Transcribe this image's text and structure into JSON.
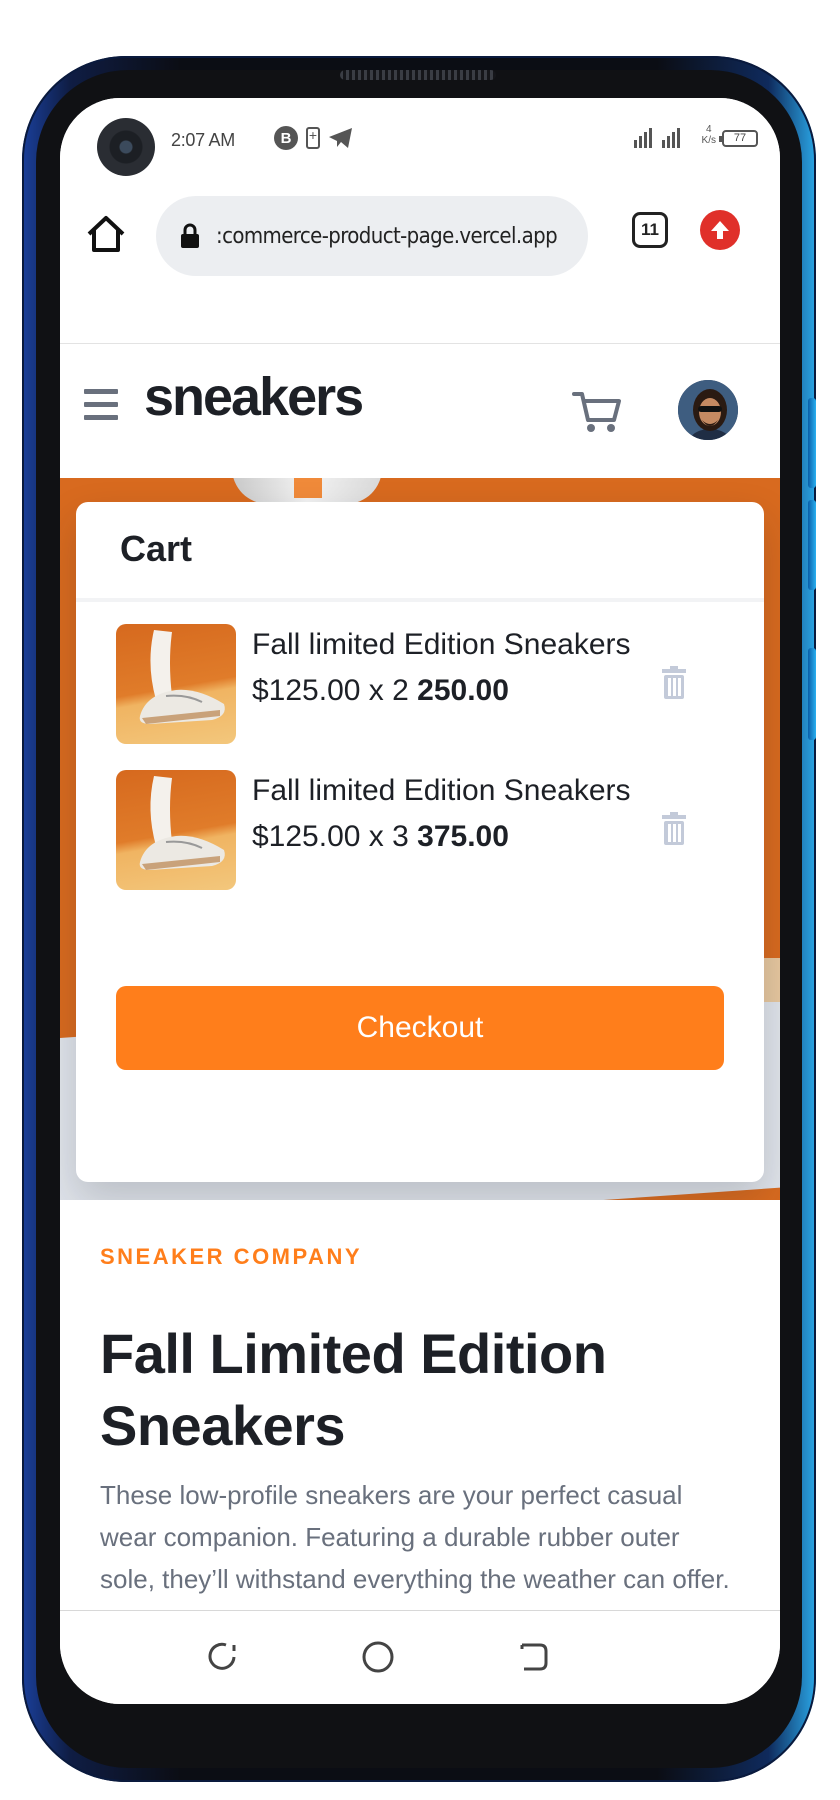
{
  "status_bar": {
    "time": "2:07 AM",
    "badge_letter": "B",
    "net_speed_value": "4",
    "net_speed_unit": "K/s",
    "battery_level": "77"
  },
  "browser": {
    "url": ":commerce-product-page.vercel.app",
    "tab_count": "11"
  },
  "header": {
    "logo": "sneakers"
  },
  "cart": {
    "title": "Cart",
    "items": [
      {
        "name": "Fall limited Edition Sneakers",
        "unit_price": "$125.00",
        "quantity_text": "x 2",
        "total": "250.00"
      },
      {
        "name": "Fall limited Edition Sneakers",
        "unit_price": "$125.00",
        "quantity_text": "x 3",
        "total": "375.00"
      }
    ],
    "checkout_label": "Checkout"
  },
  "product": {
    "company": "SNEAKER COMPANY",
    "title": "Fall Limited Edition Sneakers",
    "description": "These low-profile sneakers are your perfect casual wear companion. Featuring a durable rubber outer sole, they’ll withstand everything the weather can offer."
  },
  "colors": {
    "accent": "#ff7e1b",
    "text_dark": "#1d2026",
    "text_muted": "#69707d",
    "hero": "#d86a1f"
  },
  "icons": [
    "home-icon",
    "lock-icon",
    "tabs-icon",
    "update-icon",
    "menu-icon",
    "cart-icon",
    "trash-icon",
    "recents-icon",
    "home-nav-icon",
    "back-icon"
  ]
}
